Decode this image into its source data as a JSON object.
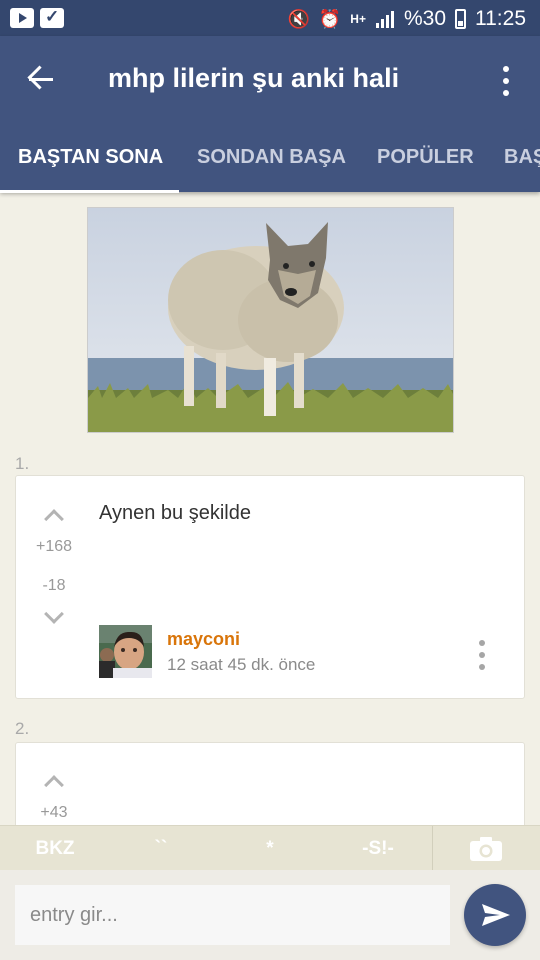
{
  "status_bar": {
    "battery_percent": "%30",
    "time": "11:25",
    "network": "H+",
    "icons": [
      "youtube-icon",
      "check-icon",
      "mute-icon",
      "alarm-icon",
      "network-icon",
      "signal-icon",
      "battery-icon"
    ]
  },
  "app_bar": {
    "title": "mhp lilerin şu anki hali",
    "icons": [
      "back-arrow-icon",
      "more-vert-icon"
    ],
    "color": "#41547f"
  },
  "tabs": [
    {
      "label": "BAŞTAN SONA",
      "active": true
    },
    {
      "label": "SONDAN BAŞA",
      "active": false
    },
    {
      "label": "POPÜLER",
      "active": false
    },
    {
      "label": "BAŞ",
      "active": false
    }
  ],
  "entries": [
    {
      "number": "1.",
      "text": "Aynen bu şekilde",
      "upvotes": "+168",
      "downvotes": "-18",
      "author": "mayconi",
      "timestamp": "12 saat 45 dk. önce"
    },
    {
      "number": "2.",
      "upvotes": "+43"
    }
  ],
  "format_bar": {
    "bkz": "BKZ",
    "backtick": "``",
    "asterisk": "*",
    "spoiler": "-S!-"
  },
  "input": {
    "placeholder": "entry gir..."
  },
  "colors": {
    "accent": "#41547f",
    "author": "#d9750a",
    "background": "#f2f0e6"
  }
}
